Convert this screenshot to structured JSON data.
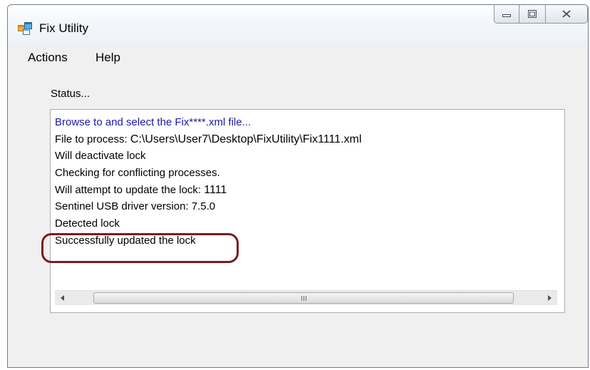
{
  "window": {
    "title": "Fix Utility",
    "icons": {
      "app": "app-window-icon",
      "minimize": "minimize-icon",
      "maximize": "maximize-icon",
      "close": "close-icon"
    }
  },
  "menu": {
    "items": [
      {
        "label": "Actions"
      },
      {
        "label": "Help"
      }
    ]
  },
  "status": {
    "label": "Status...",
    "lines": [
      {
        "text": "Browse to and select the Fix****.xml file..."
      },
      {
        "text": "File to process:",
        "value": "C:\\Users\\User7\\Desktop\\FixUtility\\Fix1111.xml"
      },
      {
        "text": "Will deactivate lock"
      },
      {
        "text": "Checking for conflicting processes."
      },
      {
        "text": "Will attempt to update the lock:",
        "value": "1111"
      },
      {
        "text": "Sentinel USB driver version: 7.5.0"
      },
      {
        "text": "Detected lock"
      },
      {
        "text": "Successfully updated the lock"
      }
    ],
    "scrollbar": {
      "left_icon": "scroll-left-icon",
      "right_icon": "scroll-right-icon",
      "thumb_grip": "III"
    }
  },
  "colors": {
    "first_line": "#1a1aa6",
    "annotation": "#7a1a22"
  }
}
